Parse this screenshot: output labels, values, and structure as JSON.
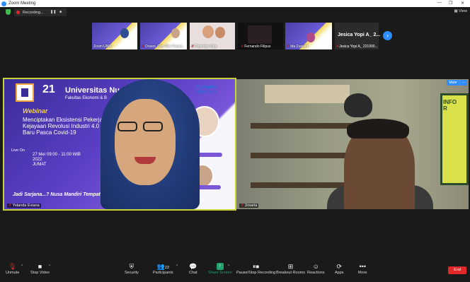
{
  "window": {
    "title": "Zoom Meeting"
  },
  "header": {
    "recording_label": "Recording...",
    "pause_icon": "pause-icon",
    "stop_icon": "stop-icon",
    "view_label": "View"
  },
  "thumbnails": [
    {
      "name": "Zoom UNM",
      "muted": false
    },
    {
      "name": "Dosen_Oby Eko Purwo...",
      "muted": true
    },
    {
      "name": "Putri dan Vika",
      "muted": true
    },
    {
      "name": "Fernando Filipus",
      "muted": true
    },
    {
      "name": "Ida Zuniarti",
      "muted": true
    },
    {
      "name": "Jesica Yopi A_ 221900...",
      "muted": true
    }
  ],
  "name_tile": {
    "big": "Jesica Yopi A_ 2..."
  },
  "video1": {
    "participant": "Yolanda Eviana",
    "banner": {
      "university": "Universitas Nu",
      "faculty": "Fakultas Ekonomi & B",
      "anniv": "21",
      "webinar": "Webinar",
      "title_lines": [
        "Menciptakan Eksistensi Pekerja",
        "Kejayaan Revolusi Industri 4.0 di",
        "Baru Pasca Covid-19"
      ],
      "live_on": "Live On",
      "date_lines": [
        "27 Mei",
        "2022",
        "JUMAT"
      ],
      "time": "09:00 - 11:00 WIB",
      "tagline": "Jadi Sarjana...? Nusa Mandiri Tempatny",
      "kampus": [
        "Kampus",
        "Merdeka"
      ]
    }
  },
  "video2": {
    "participant": "Jirsaria",
    "board_text": [
      "INFO",
      "R"
    ],
    "mute_label": "Mute",
    "more_label": "..."
  },
  "toolbar": {
    "items": [
      {
        "id": "unmute",
        "label": "Unmute",
        "icon": "mic-off-icon"
      },
      {
        "id": "stop-video",
        "label": "Stop Video",
        "icon": "video-icon"
      },
      {
        "id": "security",
        "label": "Security",
        "icon": "shield-icon"
      },
      {
        "id": "participants",
        "label": "Participants",
        "icon": "participants-icon",
        "count": "22"
      },
      {
        "id": "chat",
        "label": "Chat",
        "icon": "chat-icon"
      },
      {
        "id": "share-screen",
        "label": "Share Screen",
        "icon": "share-screen-icon"
      },
      {
        "id": "pause-stop-recording",
        "label": "Pause/Stop Recording",
        "icon": "recording-controls-icon"
      },
      {
        "id": "breakout-rooms",
        "label": "Breakout Rooms",
        "icon": "breakout-rooms-icon"
      },
      {
        "id": "reactions",
        "label": "Reactions",
        "icon": "reactions-icon"
      },
      {
        "id": "apps",
        "label": "Apps",
        "icon": "apps-icon"
      },
      {
        "id": "more",
        "label": "More",
        "icon": "more-icon"
      }
    ],
    "end_label": "End"
  },
  "colors": {
    "accent": "#2d8cff",
    "active_speaker": "#c6d43a",
    "danger": "#e02828",
    "share_green": "#23a26d"
  }
}
